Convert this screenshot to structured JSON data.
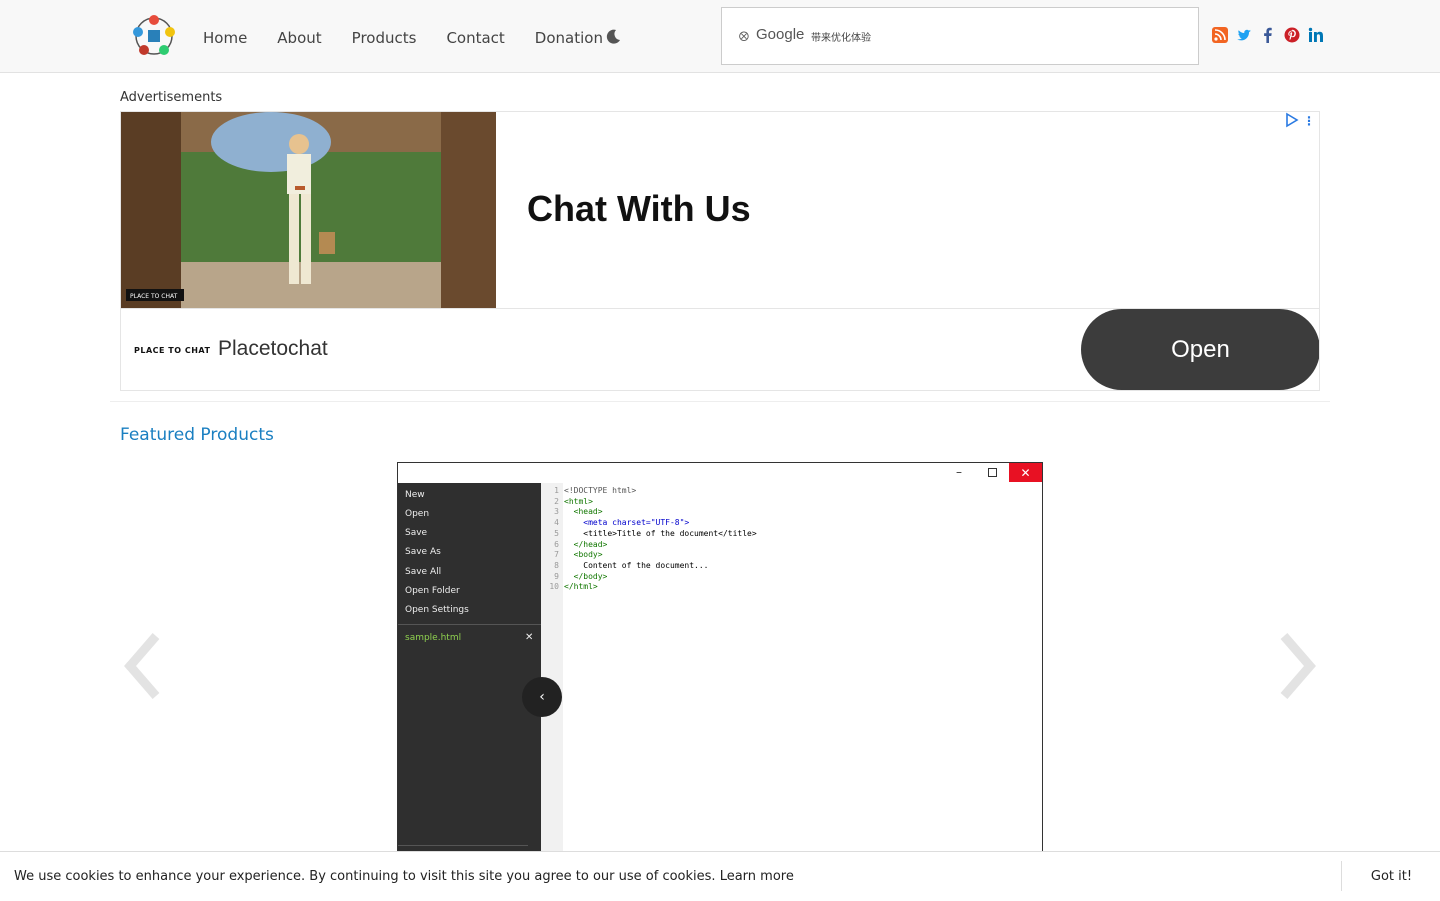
{
  "header": {
    "nav": [
      "Home",
      "About",
      "Products",
      "Contact",
      "Donation"
    ],
    "search": {
      "brand": "Google",
      "subtitle": "带来优化体验"
    },
    "theme_icon": "moon-icon",
    "social_icons": [
      "rss-icon",
      "twitter-icon",
      "facebook-icon",
      "pinterest-icon",
      "linkedin-icon"
    ]
  },
  "ads": {
    "label": "Advertisements",
    "headline": "Chat With Us",
    "brand_logo_text": "PLACE TO CHAT",
    "brand": "Placetochat",
    "cta": "Open"
  },
  "featured": {
    "title": "Featured Products"
  },
  "product_screenshot": {
    "menu": [
      "New",
      "Open",
      "Save",
      "Save As",
      "Save All",
      "Open Folder",
      "Open Settings"
    ],
    "open_file": "sample.html",
    "code_lines": [
      "<!DOCTYPE html>",
      "<html>",
      "  <head>",
      "    <meta charset=\"UTF-8\">",
      "    <title>Title of the document</title>",
      "  </head>",
      "  <body>",
      "    Content of the document...",
      "  </body>",
      "</html>"
    ]
  },
  "cookie": {
    "text": "We use cookies to enhance your experience. By continuing to visit this site you agree to our use of cookies.",
    "link": "Learn more",
    "button": "Got it!"
  },
  "colors": {
    "accent": "#1a7fc1",
    "close_red": "#e81123",
    "file_green": "#8fd14f"
  }
}
